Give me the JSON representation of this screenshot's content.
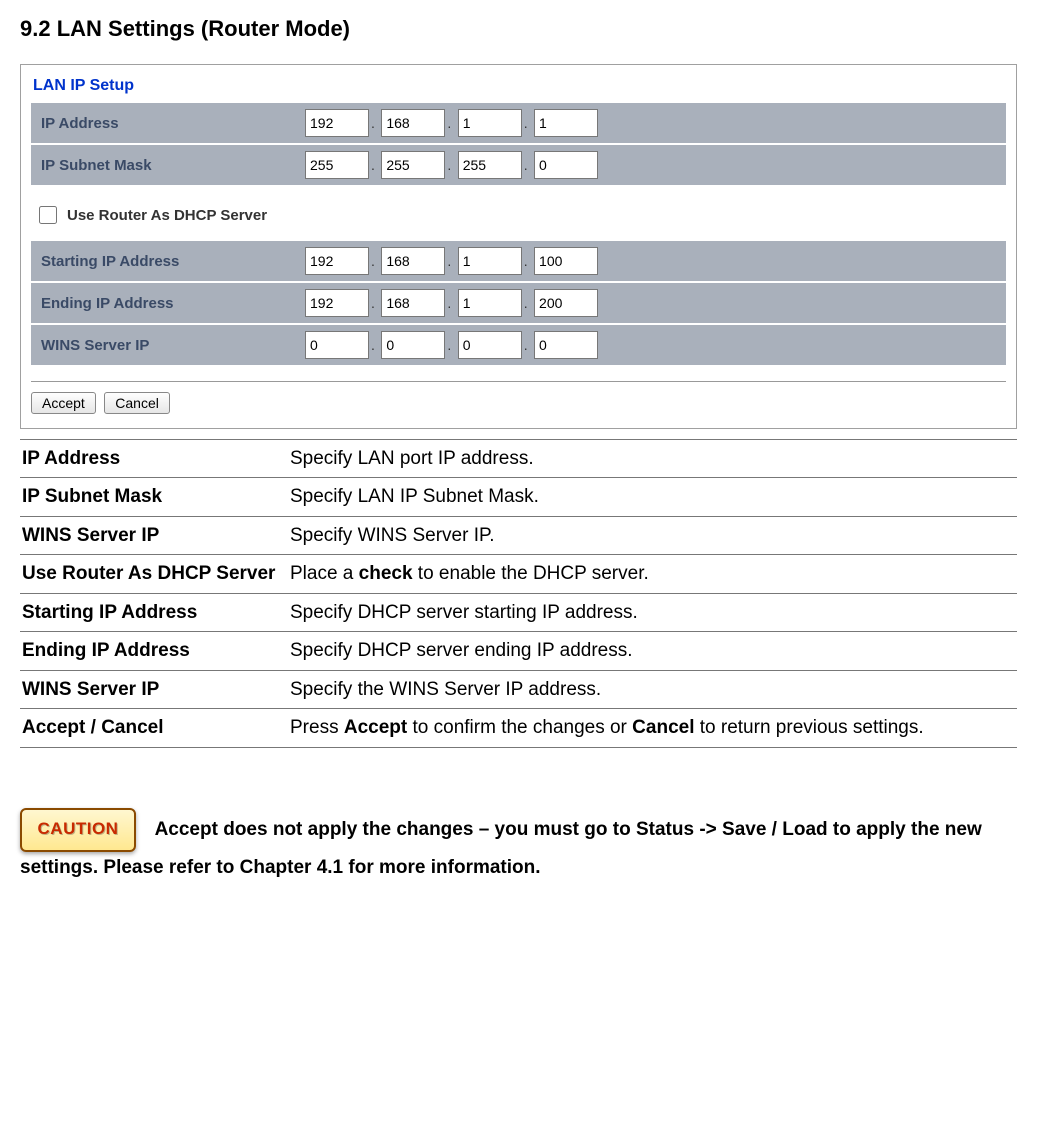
{
  "title": "9.2 LAN Settings (Router Mode)",
  "panel": {
    "heading": "LAN IP Setup",
    "rows1": {
      "ip_address": {
        "label": "IP Address",
        "octets": [
          "192",
          "168",
          "1",
          "1"
        ]
      },
      "subnet": {
        "label": "IP Subnet Mask",
        "octets": [
          "255",
          "255",
          "255",
          "0"
        ]
      }
    },
    "dhcp_label": "Use Router As DHCP Server",
    "rows2": {
      "start": {
        "label": "Starting IP Address",
        "octets": [
          "192",
          "168",
          "1",
          "100"
        ]
      },
      "end": {
        "label": "Ending IP Address",
        "octets": [
          "192",
          "168",
          "1",
          "200"
        ]
      },
      "wins": {
        "label": "WINS Server IP",
        "octets": [
          "0",
          "0",
          "0",
          "0"
        ]
      }
    },
    "accept": "Accept",
    "cancel": "Cancel"
  },
  "desc": [
    {
      "term": "IP Address",
      "def_pre": "Specify LAN port IP address.",
      "bold": "",
      "def_post": ""
    },
    {
      "term": "IP Subnet Mask",
      "def_pre": "Specify LAN IP Subnet Mask.",
      "bold": "",
      "def_post": ""
    },
    {
      "term": "WINS Server IP",
      "def_pre": "Specify WINS Server IP.",
      "bold": "",
      "def_post": ""
    },
    {
      "term": "Use Router As DHCP Server",
      "def_pre": "Place a ",
      "bold": "check",
      "def_post": " to enable the DHCP server."
    },
    {
      "term": "Starting IP Address",
      "def_pre": "Specify DHCP server starting IP address.",
      "bold": "",
      "def_post": ""
    },
    {
      "term": "Ending IP Address",
      "def_pre": "Specify DHCP server ending IP address.",
      "bold": "",
      "def_post": ""
    },
    {
      "term": "WINS Server IP",
      "def_pre": "Specify the WINS Server IP address.",
      "bold": "",
      "def_post": ""
    },
    {
      "term": "Accept / Cancel",
      "def_pre": "Press ",
      "bold": "Accept",
      "def_post": " to confirm the changes or ",
      "bold2": "Cancel",
      "def_post2": " to return previous settings."
    }
  ],
  "caution": {
    "badge": "CAUTION",
    "text": "Accept does not apply the changes – you must go to Status -> Save / Load to apply the new settings. Please refer to Chapter 4.1 for more information."
  }
}
